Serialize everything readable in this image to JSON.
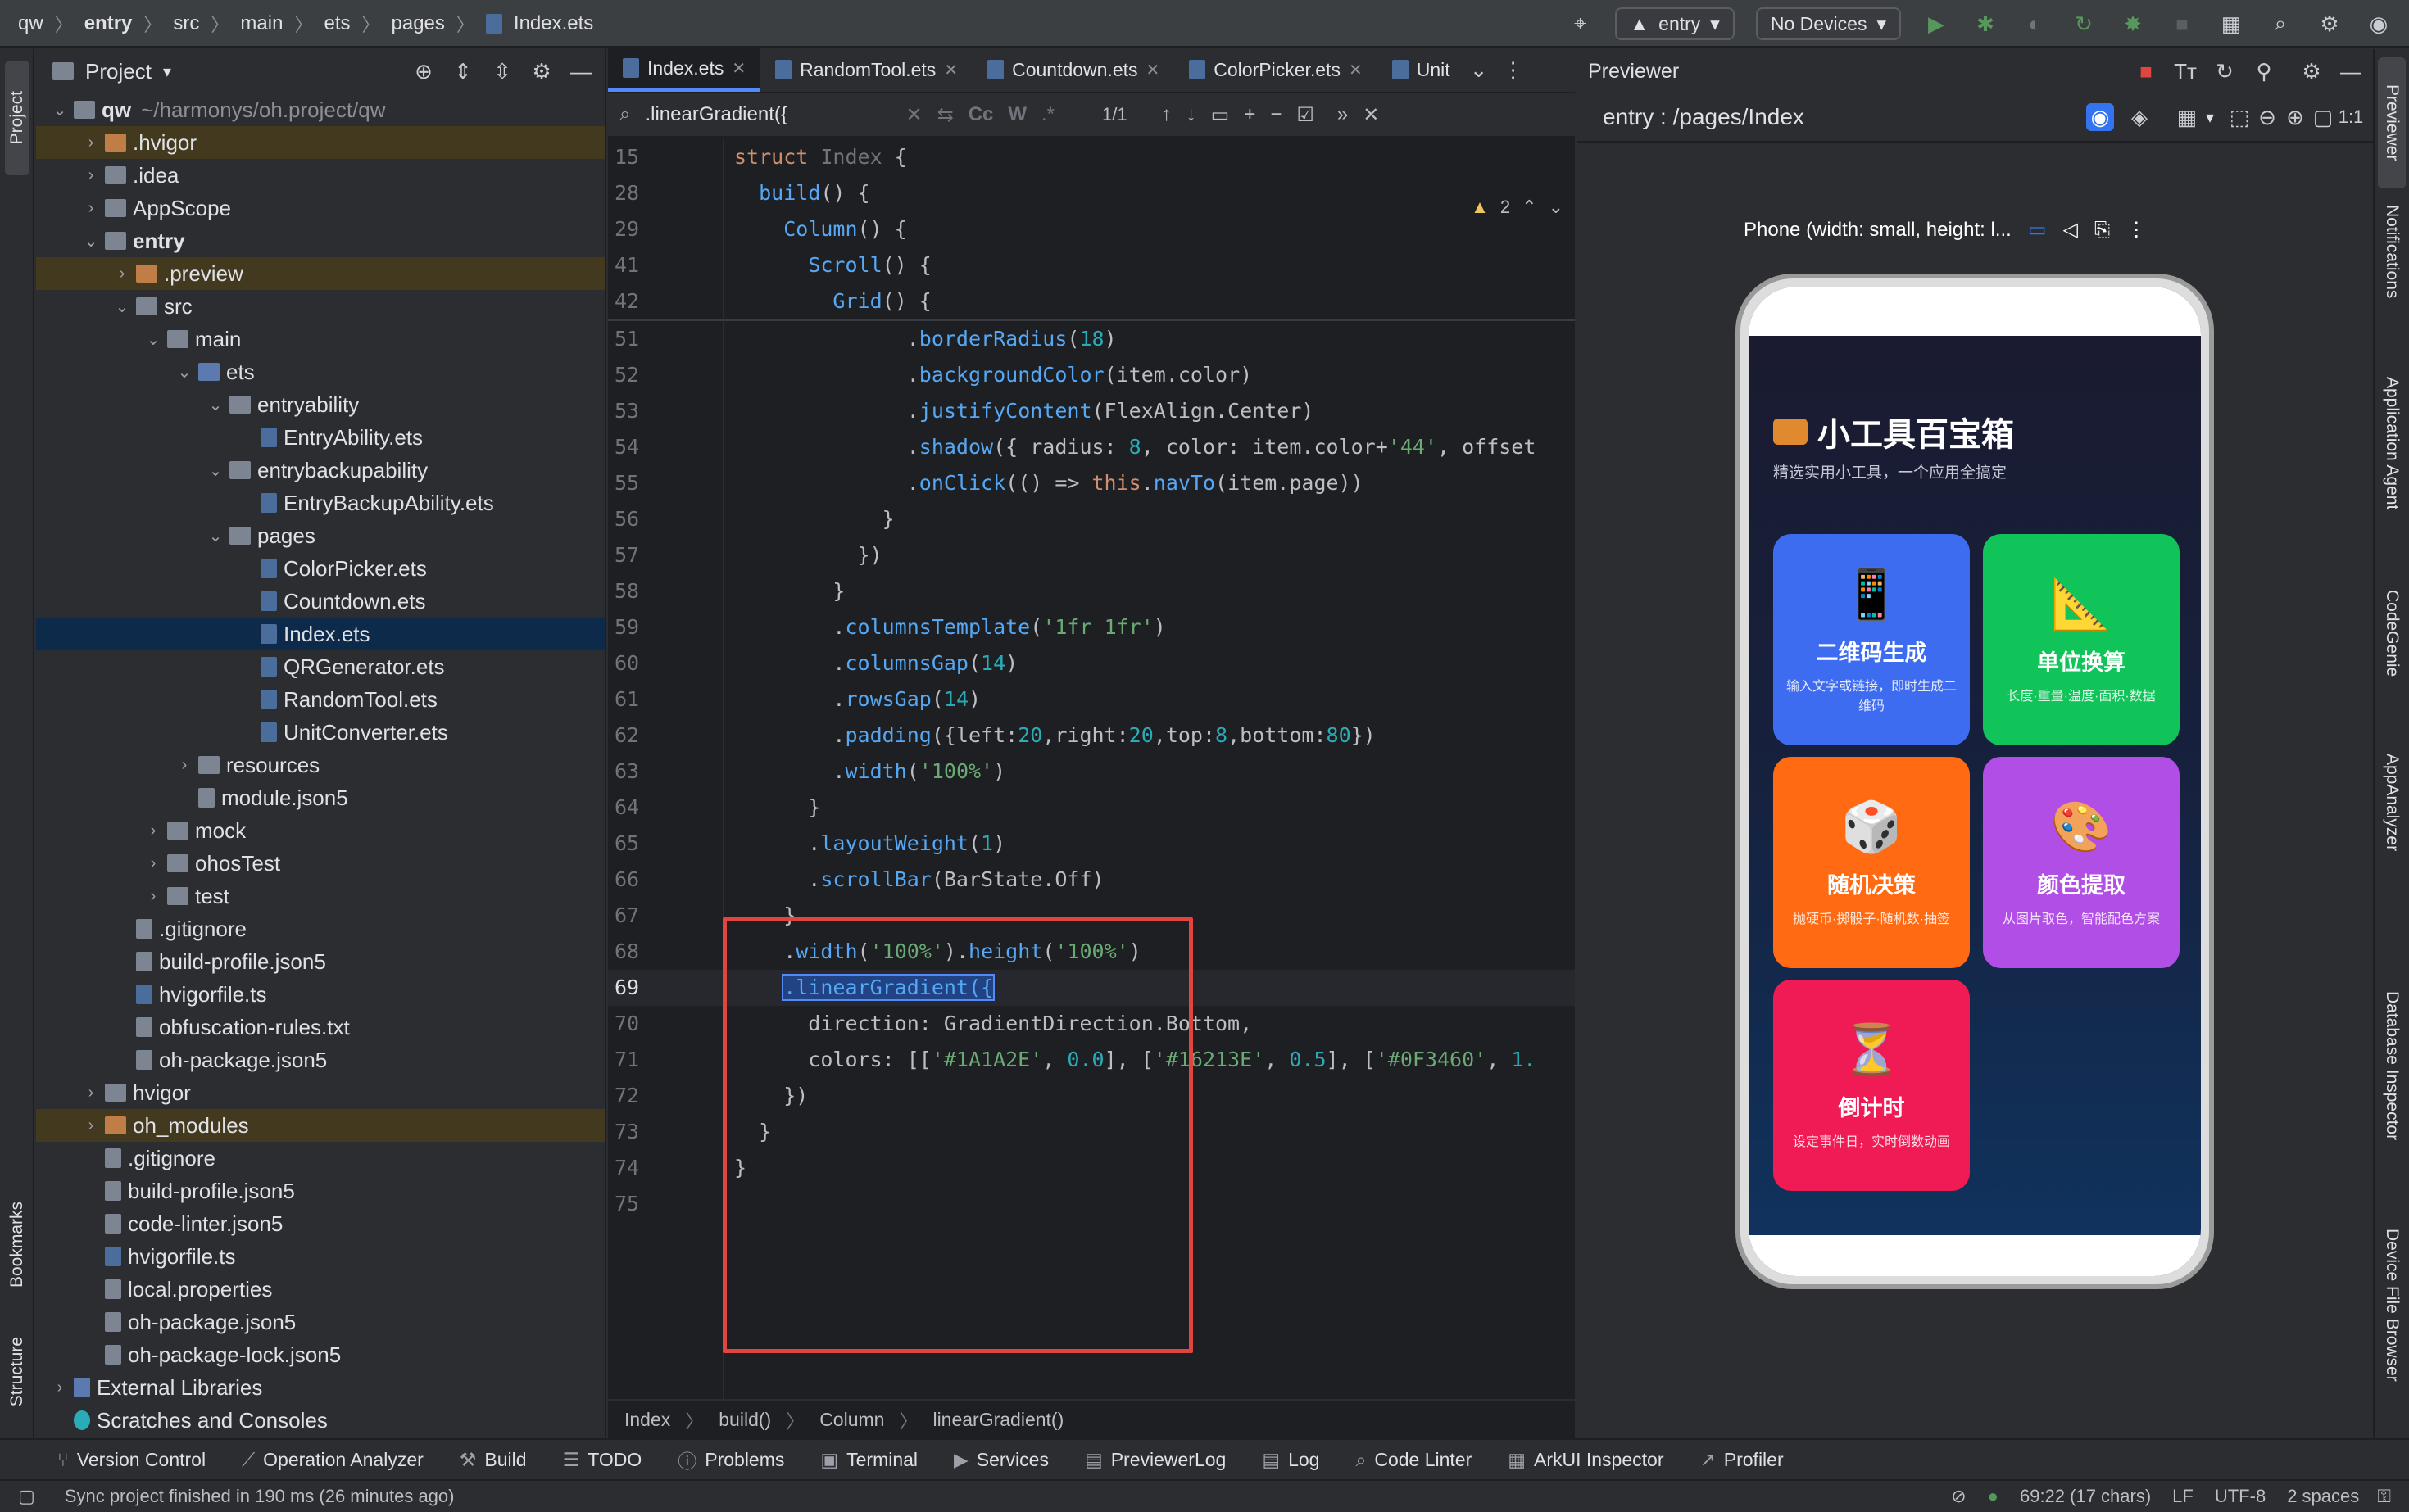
{
  "breadcrumb": [
    "qw",
    "entry",
    "src",
    "main",
    "ets",
    "pages",
    "Index.ets"
  ],
  "toolbar": {
    "run_config": "entry",
    "device": "No Devices"
  },
  "left_strip": {
    "project": "Project",
    "bookmarks": "Bookmarks",
    "structure": "Structure"
  },
  "project_panel": {
    "title": "Project",
    "rows": [
      {
        "label": "qw",
        "suffix": "~/harmonys/oh.project/qw",
        "depth": 0,
        "type": "folder",
        "chev": "v"
      },
      {
        "label": ".hvigor",
        "depth": 1,
        "type": "folder-orange",
        "chev": ">"
      },
      {
        "label": ".idea",
        "depth": 1,
        "type": "folder",
        "chev": ">"
      },
      {
        "label": "AppScope",
        "depth": 1,
        "type": "folder",
        "chev": ">"
      },
      {
        "label": "entry",
        "depth": 1,
        "type": "folder",
        "chev": "v"
      },
      {
        "label": ".preview",
        "depth": 2,
        "type": "folder-orange",
        "chev": ">"
      },
      {
        "label": "src",
        "depth": 2,
        "type": "folder",
        "chev": "v"
      },
      {
        "label": "main",
        "depth": 3,
        "type": "folder",
        "chev": "v"
      },
      {
        "label": "ets",
        "depth": 4,
        "type": "folder-blue",
        "chev": "v"
      },
      {
        "label": "entryability",
        "depth": 5,
        "type": "folder",
        "chev": "v"
      },
      {
        "label": "EntryAbility.ets",
        "depth": 6,
        "type": "ets"
      },
      {
        "label": "entrybackupability",
        "depth": 5,
        "type": "folder",
        "chev": "v"
      },
      {
        "label": "EntryBackupAbility.ets",
        "depth": 6,
        "type": "ets"
      },
      {
        "label": "pages",
        "depth": 5,
        "type": "folder",
        "chev": "v"
      },
      {
        "label": "ColorPicker.ets",
        "depth": 6,
        "type": "ets"
      },
      {
        "label": "Countdown.ets",
        "depth": 6,
        "type": "ets"
      },
      {
        "label": "Index.ets",
        "depth": 6,
        "type": "ets",
        "selected": true
      },
      {
        "label": "QRGenerator.ets",
        "depth": 6,
        "type": "ets"
      },
      {
        "label": "RandomTool.ets",
        "depth": 6,
        "type": "ets"
      },
      {
        "label": "UnitConverter.ets",
        "depth": 6,
        "type": "ets"
      },
      {
        "label": "resources",
        "depth": 4,
        "type": "folder",
        "chev": ">"
      },
      {
        "label": "module.json5",
        "depth": 4,
        "type": "file"
      },
      {
        "label": "mock",
        "depth": 3,
        "type": "folder",
        "chev": ">"
      },
      {
        "label": "ohosTest",
        "depth": 3,
        "type": "folder",
        "chev": ">"
      },
      {
        "label": "test",
        "depth": 3,
        "type": "folder",
        "chev": ">"
      },
      {
        "label": ".gitignore",
        "depth": 2,
        "type": "file"
      },
      {
        "label": "build-profile.json5",
        "depth": 2,
        "type": "file"
      },
      {
        "label": "hvigorfile.ts",
        "depth": 2,
        "type": "ts"
      },
      {
        "label": "obfuscation-rules.txt",
        "depth": 2,
        "type": "file"
      },
      {
        "label": "oh-package.json5",
        "depth": 2,
        "type": "file"
      },
      {
        "label": "hvigor",
        "depth": 1,
        "type": "folder",
        "chev": ">"
      },
      {
        "label": "oh_modules",
        "depth": 1,
        "type": "folder-orange",
        "chev": ">"
      },
      {
        "label": ".gitignore",
        "depth": 1,
        "type": "file"
      },
      {
        "label": "build-profile.json5",
        "depth": 1,
        "type": "file"
      },
      {
        "label": "code-linter.json5",
        "depth": 1,
        "type": "file"
      },
      {
        "label": "hvigorfile.ts",
        "depth": 1,
        "type": "ts"
      },
      {
        "label": "local.properties",
        "depth": 1,
        "type": "file"
      },
      {
        "label": "oh-package.json5",
        "depth": 1,
        "type": "file"
      },
      {
        "label": "oh-package-lock.json5",
        "depth": 1,
        "type": "file"
      },
      {
        "label": "External Libraries",
        "depth": 0,
        "type": "lib",
        "chev": ">"
      },
      {
        "label": "Scratches and Consoles",
        "depth": 0,
        "type": "scratch"
      }
    ]
  },
  "editor": {
    "tabs": [
      "Index.ets",
      "RandomTool.ets",
      "Countdown.ets",
      "ColorPicker.ets",
      "Unit"
    ],
    "find": {
      "query": ".linearGradient({",
      "matches": "1/1",
      "case": "Cc",
      "word": "W"
    },
    "warnings": "2",
    "sticky": [
      {
        "n": "15",
        "parts": [
          [
            "kw",
            "struct "
          ],
          [
            "mut",
            "Index "
          ],
          [
            "id",
            "{"
          ]
        ]
      },
      {
        "n": "28",
        "parts": [
          [
            "id",
            "  "
          ],
          [
            "fn",
            "build"
          ],
          [
            "id",
            "() {"
          ]
        ]
      },
      {
        "n": "29",
        "parts": [
          [
            "id",
            "    "
          ],
          [
            "fn",
            "Column"
          ],
          [
            "id",
            "() {"
          ]
        ]
      },
      {
        "n": "41",
        "parts": [
          [
            "id",
            "      "
          ],
          [
            "fn",
            "Scroll"
          ],
          [
            "id",
            "() {"
          ]
        ]
      },
      {
        "n": "42",
        "parts": [
          [
            "id",
            "        "
          ],
          [
            "fn",
            "Grid"
          ],
          [
            "id",
            "() {"
          ]
        ]
      }
    ],
    "lines": [
      {
        "n": "51",
        "parts": [
          [
            "id",
            "              ."
          ],
          [
            "fn",
            "borderRadius"
          ],
          [
            "id",
            "("
          ],
          [
            "num",
            "18"
          ],
          [
            "id",
            ")"
          ]
        ]
      },
      {
        "n": "52",
        "parts": [
          [
            "id",
            "              ."
          ],
          [
            "fn",
            "backgroundColor"
          ],
          [
            "id",
            "(item.color)"
          ]
        ]
      },
      {
        "n": "53",
        "parts": [
          [
            "id",
            "              ."
          ],
          [
            "fn",
            "justifyContent"
          ],
          [
            "id",
            "(FlexAlign.Center)"
          ]
        ]
      },
      {
        "n": "54",
        "parts": [
          [
            "id",
            "              ."
          ],
          [
            "fn",
            "shadow"
          ],
          [
            "id",
            "({ radius: "
          ],
          [
            "num",
            "8"
          ],
          [
            "id",
            ", color: item.color+"
          ],
          [
            "str",
            "'44'"
          ],
          [
            "id",
            ", offset"
          ]
        ]
      },
      {
        "n": "55",
        "parts": [
          [
            "id",
            "              ."
          ],
          [
            "fn",
            "onClick"
          ],
          [
            "id",
            "(() => "
          ],
          [
            "kw",
            "this"
          ],
          [
            "id",
            "."
          ],
          [
            "fn",
            "navTo"
          ],
          [
            "id",
            "(item.page))"
          ]
        ]
      },
      {
        "n": "56",
        "parts": [
          [
            "id",
            "            }"
          ]
        ]
      },
      {
        "n": "57",
        "parts": [
          [
            "id",
            "          })"
          ]
        ]
      },
      {
        "n": "58",
        "parts": [
          [
            "id",
            "        }"
          ]
        ]
      },
      {
        "n": "59",
        "parts": [
          [
            "id",
            "        ."
          ],
          [
            "fn",
            "columnsTemplate"
          ],
          [
            "id",
            "("
          ],
          [
            "str",
            "'1fr 1fr'"
          ],
          [
            "id",
            ")"
          ]
        ]
      },
      {
        "n": "60",
        "parts": [
          [
            "id",
            "        ."
          ],
          [
            "fn",
            "columnsGap"
          ],
          [
            "id",
            "("
          ],
          [
            "num",
            "14"
          ],
          [
            "id",
            ")"
          ]
        ]
      },
      {
        "n": "61",
        "parts": [
          [
            "id",
            "        ."
          ],
          [
            "fn",
            "rowsGap"
          ],
          [
            "id",
            "("
          ],
          [
            "num",
            "14"
          ],
          [
            "id",
            ")"
          ]
        ]
      },
      {
        "n": "62",
        "parts": [
          [
            "id",
            "        ."
          ],
          [
            "fn",
            "padding"
          ],
          [
            "id",
            "({left:"
          ],
          [
            "num",
            "20"
          ],
          [
            "id",
            ",right:"
          ],
          [
            "num",
            "20"
          ],
          [
            "id",
            ",top:"
          ],
          [
            "num",
            "8"
          ],
          [
            "id",
            ",bottom:"
          ],
          [
            "num",
            "80"
          ],
          [
            "id",
            "})"
          ]
        ]
      },
      {
        "n": "63",
        "parts": [
          [
            "id",
            "        ."
          ],
          [
            "fn",
            "width"
          ],
          [
            "id",
            "("
          ],
          [
            "str",
            "'100%'"
          ],
          [
            "id",
            ")"
          ]
        ]
      },
      {
        "n": "64",
        "parts": [
          [
            "id",
            "      }"
          ]
        ]
      },
      {
        "n": "65",
        "parts": [
          [
            "id",
            "      ."
          ],
          [
            "fn",
            "layoutWeight"
          ],
          [
            "id",
            "("
          ],
          [
            "num",
            "1"
          ],
          [
            "id",
            ")"
          ]
        ]
      },
      {
        "n": "66",
        "parts": [
          [
            "id",
            "      ."
          ],
          [
            "fn",
            "scrollBar"
          ],
          [
            "id",
            "(BarState.Off)"
          ]
        ]
      },
      {
        "n": "67",
        "parts": [
          [
            "id",
            "    }"
          ]
        ]
      },
      {
        "n": "68",
        "parts": [
          [
            "id",
            "    ."
          ],
          [
            "fn",
            "width"
          ],
          [
            "id",
            "("
          ],
          [
            "str",
            "'100%'"
          ],
          [
            "id",
            ")."
          ],
          [
            "fn",
            "height"
          ],
          [
            "id",
            "("
          ],
          [
            "str",
            "'100%'"
          ],
          [
            "id",
            ")"
          ]
        ]
      },
      {
        "n": "69",
        "parts": [
          [
            "id",
            "    "
          ],
          [
            "sel",
            ".linearGradient({"
          ]
        ]
      },
      {
        "n": "70",
        "parts": [
          [
            "id",
            "      direction: GradientDirection.Bottom,"
          ]
        ]
      },
      {
        "n": "71",
        "parts": [
          [
            "id",
            "      colors: [["
          ],
          [
            "str",
            "'#1A1A2E'"
          ],
          [
            "id",
            ", "
          ],
          [
            "num",
            "0.0"
          ],
          [
            "id",
            "], ["
          ],
          [
            "str",
            "'#16213E'"
          ],
          [
            "id",
            ", "
          ],
          [
            "num",
            "0.5"
          ],
          [
            "id",
            "], ["
          ],
          [
            "str",
            "'#0F3460'"
          ],
          [
            "id",
            ", "
          ],
          [
            "num",
            "1."
          ]
        ]
      },
      {
        "n": "72",
        "parts": [
          [
            "id",
            "    })"
          ]
        ]
      },
      {
        "n": "73",
        "parts": [
          [
            "id",
            "  }"
          ]
        ]
      },
      {
        "n": "74",
        "parts": [
          [
            "id",
            "}"
          ]
        ]
      },
      {
        "n": "75",
        "parts": [
          [
            "id",
            ""
          ]
        ]
      }
    ],
    "status_crumbs": [
      "Index",
      "build()",
      "Column",
      "linearGradient()"
    ]
  },
  "previewer": {
    "title": "Previewer",
    "route": "entry : /pages/Index",
    "device_label": "Phone (width: small, height: l...",
    "app": {
      "title": "小工具百宝箱",
      "subtitle": "精选实用小工具，一个应用全搞定",
      "cards": [
        {
          "name": "二维码生成",
          "desc": "输入文字或链接，即时生成二维码",
          "color": "#3d6cf0",
          "emo": "📱"
        },
        {
          "name": "单位换算",
          "desc": "长度·重量·温度·面积·数据",
          "color": "#10c45a",
          "emo": "📐"
        },
        {
          "name": "随机决策",
          "desc": "抛硬币·掷骰子·随机数·抽签",
          "color": "#ff6a13",
          "emo": "🎲"
        },
        {
          "name": "颜色提取",
          "desc": "从图片取色，智能配色方案",
          "color": "#b14ee6",
          "emo": "🎨"
        },
        {
          "name": "倒计时",
          "desc": "设定事件日，实时倒数动画",
          "color": "#f01a55",
          "emo": "⏳"
        }
      ]
    }
  },
  "right_strip": [
    "Previewer",
    "Notifications",
    "Application Agent",
    "CodeGenie",
    "AppAnalyzer",
    "Database Inspector",
    "Device File Browser"
  ],
  "bottom_tools": [
    "Version Control",
    "Operation Analyzer",
    "Build",
    "TODO",
    "Problems",
    "Terminal",
    "Services",
    "PreviewerLog",
    "Log",
    "Code Linter",
    "ArkUI Inspector",
    "Profiler"
  ],
  "status": {
    "message": "Sync project finished in 190 ms (26 minutes ago)",
    "position": "69:22 (17 chars)",
    "line_sep": "LF",
    "encoding": "UTF-8",
    "indent": "2 spaces"
  },
  "colors": {
    "highlight_box": "#e0463e",
    "accent": "#548af7"
  }
}
